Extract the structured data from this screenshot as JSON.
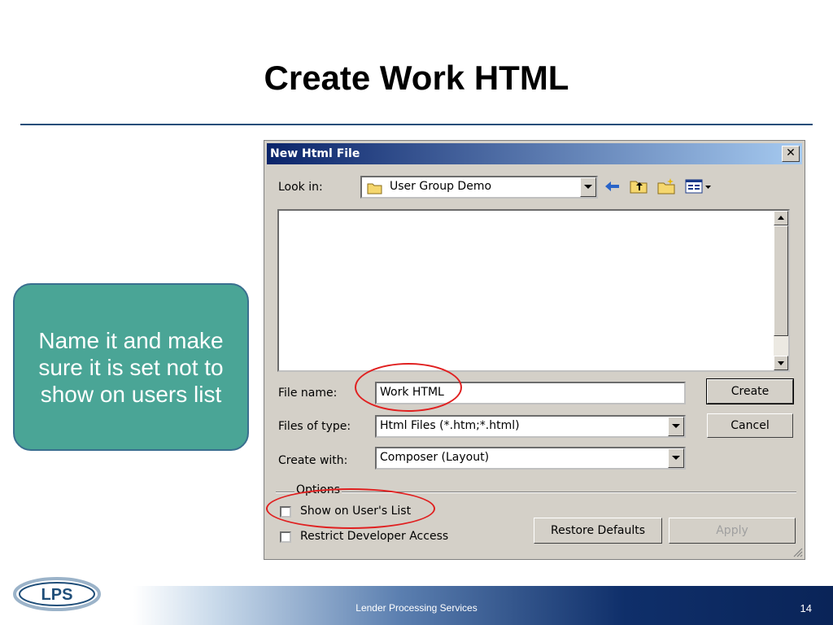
{
  "slide": {
    "title": "Create Work HTML",
    "callout": "Name it and make sure it is set not to show on users list",
    "footer_text": "Lender Processing Services",
    "page_number": "14",
    "logo_text": "LPS"
  },
  "dialog": {
    "title": "New Html File",
    "close_label": "✕",
    "look_in_label": "Look in:",
    "look_in_value": "User Group Demo",
    "file_name_label": "File name:",
    "file_name_value": "Work HTML",
    "files_of_type_label": "Files of type:",
    "files_of_type_value": "Html Files (*.htm;*.html)",
    "create_with_label": "Create with:",
    "create_with_value": "Composer (Layout)",
    "create_button": "Create",
    "cancel_button": "Cancel",
    "options_label": "Options",
    "show_on_users_list_label": "Show on User's List",
    "show_on_users_list_checked": false,
    "restrict_dev_access_label": "Restrict Developer Access",
    "restrict_dev_access_checked": false,
    "restore_defaults_button": "Restore Defaults",
    "apply_button": "Apply"
  },
  "icons": [
    "folder-icon",
    "back-arrow-icon",
    "up-folder-icon",
    "new-folder-icon",
    "view-menu-icon"
  ],
  "colors": {
    "callout_fill": "#4aa596",
    "title_rule": "#1f4e79",
    "annotation": "#e02020",
    "footer_dark": "#0a2458"
  }
}
